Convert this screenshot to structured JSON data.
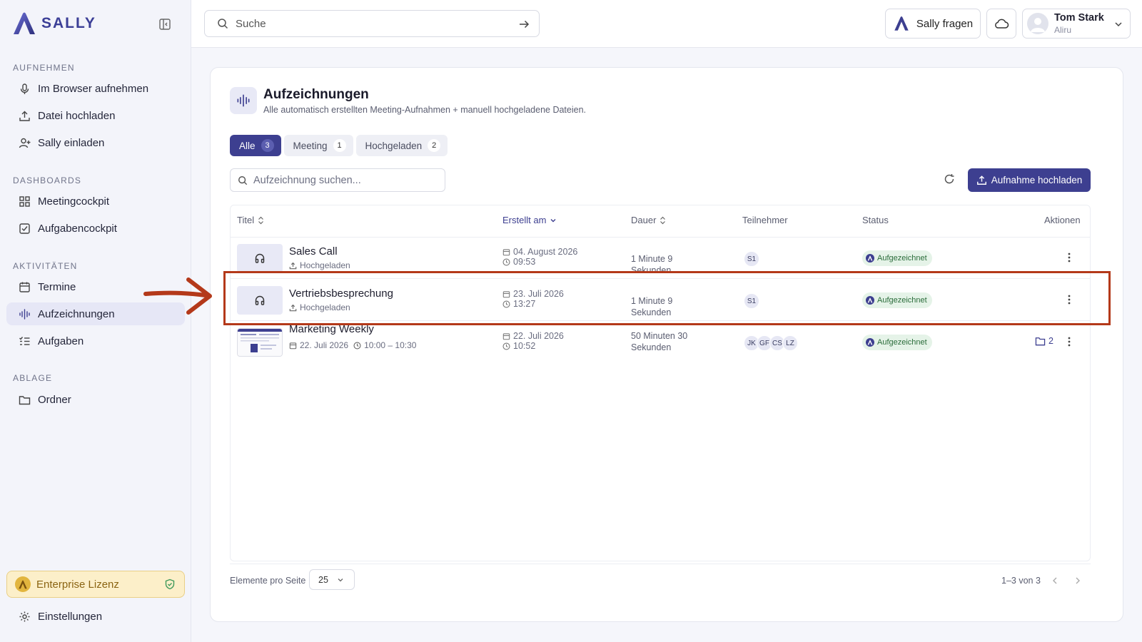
{
  "brand": {
    "name": "SALLY",
    "accent": "#3d3f90"
  },
  "sidebar": {
    "sections": [
      {
        "label": "AUFNEHMEN",
        "items": [
          {
            "label": "Im Browser aufnehmen",
            "icon": "mic-icon"
          },
          {
            "label": "Datei hochladen",
            "icon": "upload-icon"
          },
          {
            "label": "Sally einladen",
            "icon": "user-plus-icon"
          }
        ]
      },
      {
        "label": "DASHBOARDS",
        "items": [
          {
            "label": "Meetingcockpit",
            "icon": "grid-icon"
          },
          {
            "label": "Aufgabencockpit",
            "icon": "checkbox-icon"
          }
        ]
      },
      {
        "label": "AKTIVITÄTEN",
        "items": [
          {
            "label": "Termine",
            "icon": "calendar-icon"
          },
          {
            "label": "Aufzeichnungen",
            "icon": "waveform-icon",
            "active": true
          },
          {
            "label": "Aufgaben",
            "icon": "tasklist-icon"
          }
        ]
      },
      {
        "label": "ABLAGE",
        "items": [
          {
            "label": "Ordner",
            "icon": "folder-icon"
          }
        ]
      }
    ],
    "license": "Enterprise Lizenz",
    "settings": "Einstellungen"
  },
  "header": {
    "search_placeholder": "Suche",
    "ask_label": "Sally fragen",
    "user": {
      "name": "Tom Stark",
      "org": "Aliru"
    }
  },
  "page": {
    "title": "Aufzeichnungen",
    "subtitle": "Alle automatisch erstellten Meeting-Aufnahmen + manuell hochgeladene Dateien.",
    "tabs": [
      {
        "label": "Alle",
        "count": "3",
        "active": true
      },
      {
        "label": "Meeting",
        "count": "1"
      },
      {
        "label": "Hochgeladen",
        "count": "2"
      }
    ],
    "search_placeholder": "Aufzeichnung suchen...",
    "upload_label": "Aufnahme hochladen"
  },
  "table": {
    "columns": {
      "title": "Titel",
      "created": "Erstellt am",
      "duration": "Dauer",
      "participants": "Teilnehmer",
      "status": "Status",
      "actions": "Aktionen"
    },
    "rows": [
      {
        "title": "Sales Call",
        "sub": "Hochgeladen",
        "date": "04. August 2026",
        "time": "09:53",
        "duration": "1 Minute 9 Sekunden",
        "participants": [
          "S1"
        ],
        "status": "Aufgezeichnet"
      },
      {
        "title": "Vertriebsbesprechung",
        "sub": "Hochgeladen",
        "date": "23. Juli 2026",
        "time": "13:27",
        "duration": "1 Minute 9 Sekunden",
        "participants": [
          "S1"
        ],
        "status": "Aufgezeichnet"
      },
      {
        "title": "Marketing Weekly",
        "sub_date": "22. Juli 2026",
        "sub_time": "10:00 – 10:30",
        "date": "22. Juli 2026",
        "time": "10:52",
        "duration": "50 Minuten 30 Sekunden",
        "participants": [
          "JK",
          "GF",
          "CS",
          "LZ"
        ],
        "status": "Aufgezeichnet",
        "folder_count": "2"
      }
    ]
  },
  "pagination": {
    "per_page_label": "Elemente pro Seite",
    "per_page": "25",
    "range": "1–3 von 3"
  }
}
